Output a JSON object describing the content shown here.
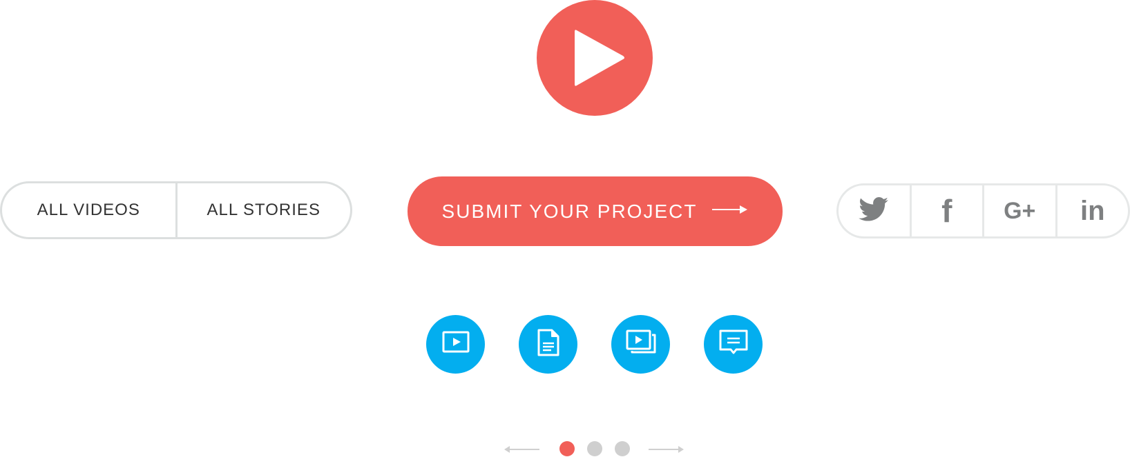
{
  "colors": {
    "accent": "#f15f58",
    "blue": "#03aeef",
    "border": "#dcdfdf",
    "icon_gray": "#7e8081",
    "dot_inactive": "#cfcfcf"
  },
  "play": {
    "icon": "play-icon"
  },
  "filters": {
    "all_videos": "ALL VIDEOS",
    "all_stories": "ALL STORIES"
  },
  "cta": {
    "label": "SUBMIT YOUR PROJECT",
    "icon": "arrow-right-icon"
  },
  "social": [
    {
      "icon": "twitter-icon"
    },
    {
      "icon": "facebook-icon",
      "glyph": "f"
    },
    {
      "icon": "google-plus-icon",
      "glyph": "G+"
    },
    {
      "icon": "linkedin-icon",
      "glyph": "in"
    }
  ],
  "content_types": [
    {
      "icon": "video-icon"
    },
    {
      "icon": "document-icon"
    },
    {
      "icon": "gallery-icon"
    },
    {
      "icon": "comment-icon"
    }
  ],
  "pagination": {
    "pages": 3,
    "active_page": 1
  }
}
